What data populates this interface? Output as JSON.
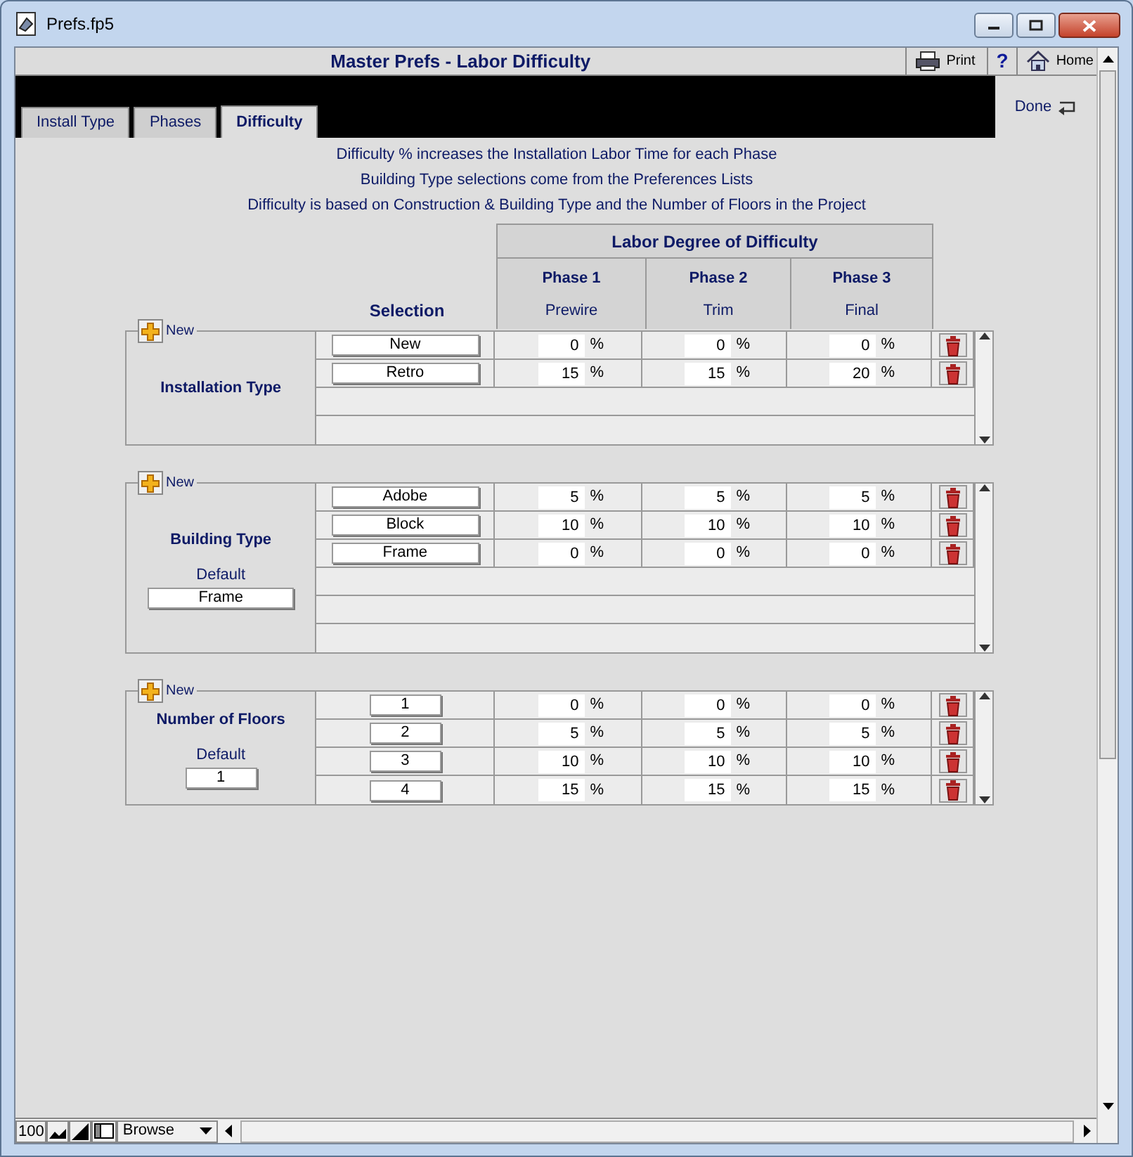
{
  "window": {
    "title": "Prefs.fp5"
  },
  "header": {
    "title": "Master Prefs - Labor Difficulty",
    "print_label": "Print",
    "help_label": "?",
    "home_label": "Home"
  },
  "tabs": [
    {
      "label": "Install Type",
      "selected": false
    },
    {
      "label": "Phases",
      "selected": false
    },
    {
      "label": "Difficulty",
      "selected": true
    }
  ],
  "done_button": {
    "label": "Done"
  },
  "notes": [
    "Difficulty % increases the Installation Labor Time for each Phase",
    "Building Type selections come from the Preferences Lists",
    "Difficulty is based on Construction & Building Type and the Number of Floors in the Project"
  ],
  "table_header": {
    "group": "Labor Degree of Difficulty",
    "selection": "Selection",
    "phases": [
      {
        "name": "Phase 1",
        "sub": "Prewire"
      },
      {
        "name": "Phase 2",
        "sub": "Trim"
      },
      {
        "name": "Phase 3",
        "sub": "Final"
      }
    ]
  },
  "sections": [
    {
      "kind": "text",
      "new_label": "New",
      "title": "Installation Type",
      "rows": [
        {
          "kind": "entry",
          "selection": "New",
          "values": [
            {
              "value": "0",
              "unit": "%"
            },
            {
              "value": "0",
              "unit": "%"
            },
            {
              "value": "0",
              "unit": "%"
            }
          ]
        },
        {
          "kind": "entry",
          "selection": "Retro",
          "values": [
            {
              "value": "15",
              "unit": "%"
            },
            {
              "value": "15",
              "unit": "%"
            },
            {
              "value": "20",
              "unit": "%"
            }
          ]
        },
        {
          "kind": "empty"
        },
        {
          "kind": "empty"
        }
      ]
    },
    {
      "kind": "text",
      "new_label": "New",
      "title": "Building Type",
      "default_label": "Default",
      "default_value": "Frame",
      "rows": [
        {
          "kind": "entry",
          "selection": "Adobe",
          "values": [
            {
              "value": "5",
              "unit": "%"
            },
            {
              "value": "5",
              "unit": "%"
            },
            {
              "value": "5",
              "unit": "%"
            }
          ]
        },
        {
          "kind": "entry",
          "selection": "Block",
          "values": [
            {
              "value": "10",
              "unit": "%"
            },
            {
              "value": "10",
              "unit": "%"
            },
            {
              "value": "10",
              "unit": "%"
            }
          ]
        },
        {
          "kind": "entry",
          "selection": "Frame",
          "values": [
            {
              "value": "0",
              "unit": "%"
            },
            {
              "value": "0",
              "unit": "%"
            },
            {
              "value": "0",
              "unit": "%"
            }
          ]
        },
        {
          "kind": "empty"
        },
        {
          "kind": "empty"
        },
        {
          "kind": "empty"
        }
      ]
    },
    {
      "kind": "number",
      "new_label": "New",
      "title": "Number of Floors",
      "default_label": "Default",
      "default_value": "1",
      "rows": [
        {
          "kind": "entry",
          "selection": "1",
          "values": [
            {
              "value": "0",
              "unit": "%"
            },
            {
              "value": "0",
              "unit": "%"
            },
            {
              "value": "0",
              "unit": "%"
            }
          ]
        },
        {
          "kind": "entry",
          "selection": "2",
          "values": [
            {
              "value": "5",
              "unit": "%"
            },
            {
              "value": "5",
              "unit": "%"
            },
            {
              "value": "5",
              "unit": "%"
            }
          ]
        },
        {
          "kind": "entry",
          "selection": "3",
          "values": [
            {
              "value": "10",
              "unit": "%"
            },
            {
              "value": "10",
              "unit": "%"
            },
            {
              "value": "10",
              "unit": "%"
            }
          ]
        },
        {
          "kind": "entry",
          "selection": "4",
          "values": [
            {
              "value": "15",
              "unit": "%"
            },
            {
              "value": "15",
              "unit": "%"
            },
            {
              "value": "15",
              "unit": "%"
            }
          ]
        }
      ]
    }
  ],
  "status_bar": {
    "zoom": "100",
    "mode": "Browse"
  }
}
